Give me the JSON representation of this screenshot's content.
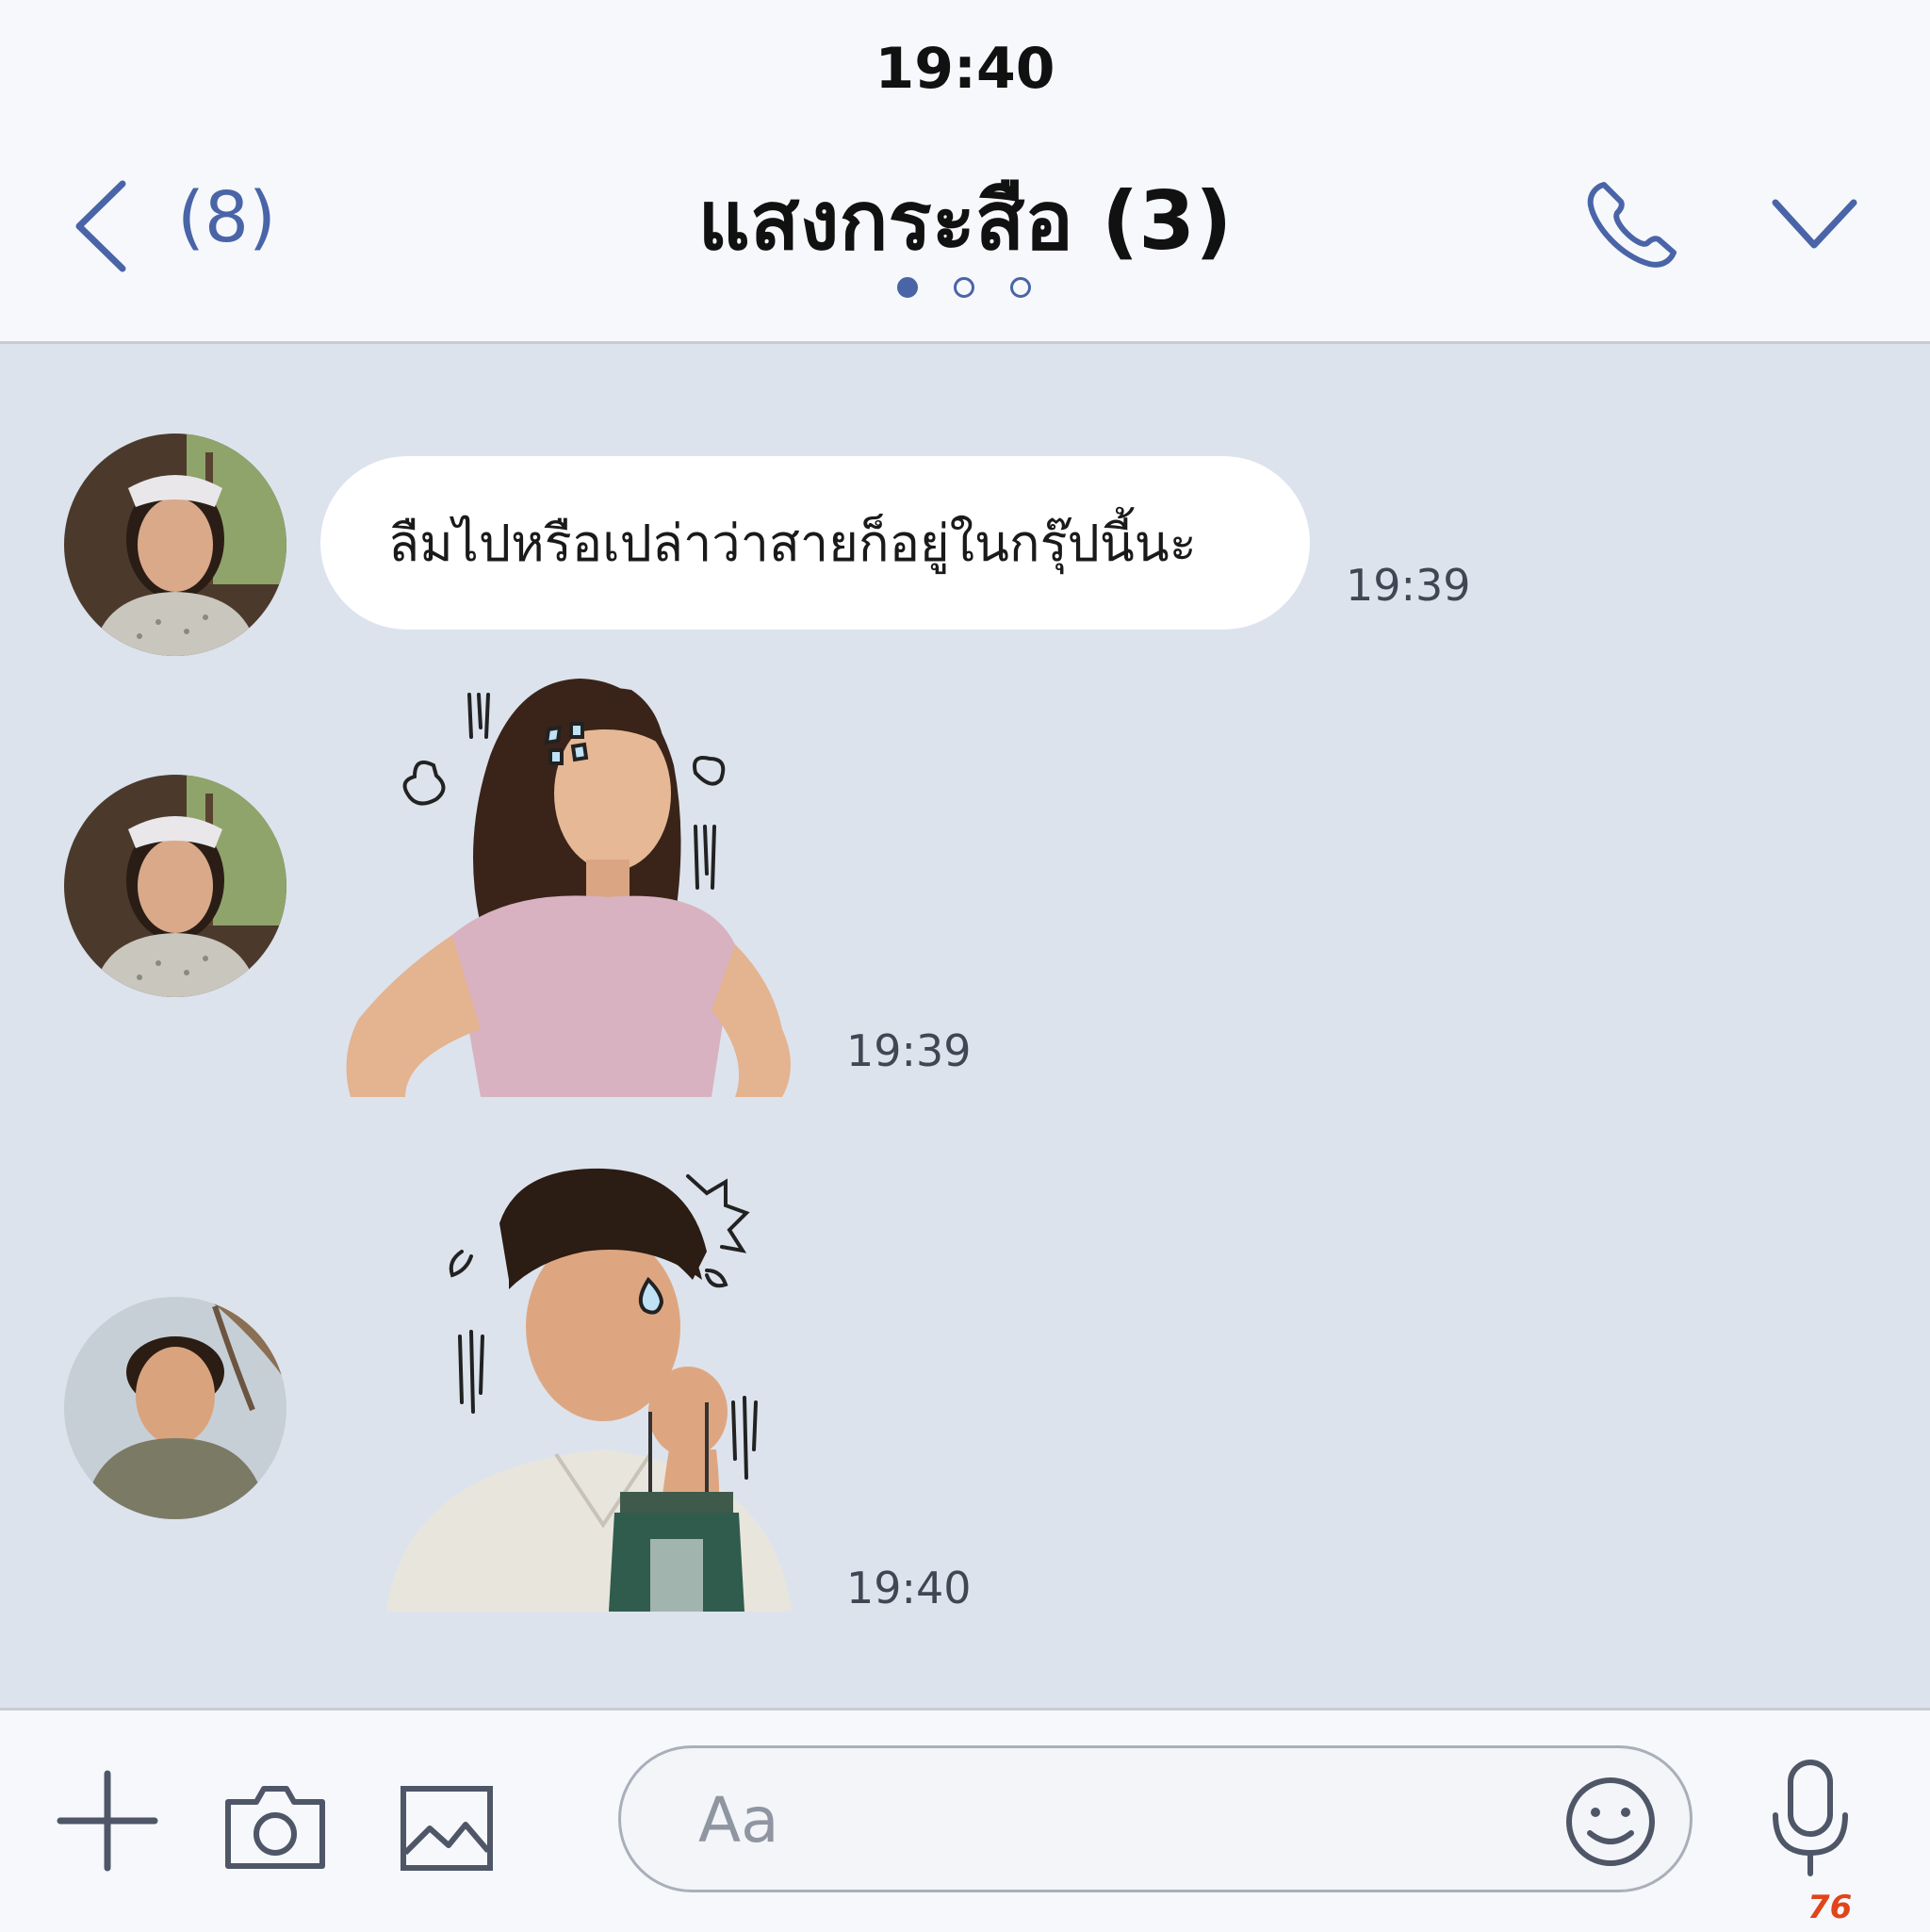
{
  "status_bar": {
    "time": "19:40"
  },
  "header": {
    "unread_count": "(8)",
    "title": "แสงกระสือ (3)",
    "page_dots": 3,
    "active_dot": 0,
    "accent_color": "#4a64a8"
  },
  "messages": [
    {
      "type": "text",
      "sender_avatar": "woman-nurse-avatar",
      "text": "ลืมไปหรือเปล่าว่าสายก็อยู่ในกรุ๊ปนี้นะ",
      "time": "19:39"
    },
    {
      "type": "sticker",
      "sender_avatar": "woman-nurse-avatar",
      "sticker": "angry-woman-sticker",
      "time": "19:39"
    },
    {
      "type": "sticker",
      "sender_avatar": "man-avatar",
      "sticker": "worried-man-lantern-sticker",
      "time": "19:40"
    }
  ],
  "input_bar": {
    "placeholder": "Aa",
    "icons": [
      "plus-icon",
      "camera-icon",
      "image-icon",
      "emoji-icon",
      "microphone-icon"
    ]
  },
  "watermark": "76"
}
